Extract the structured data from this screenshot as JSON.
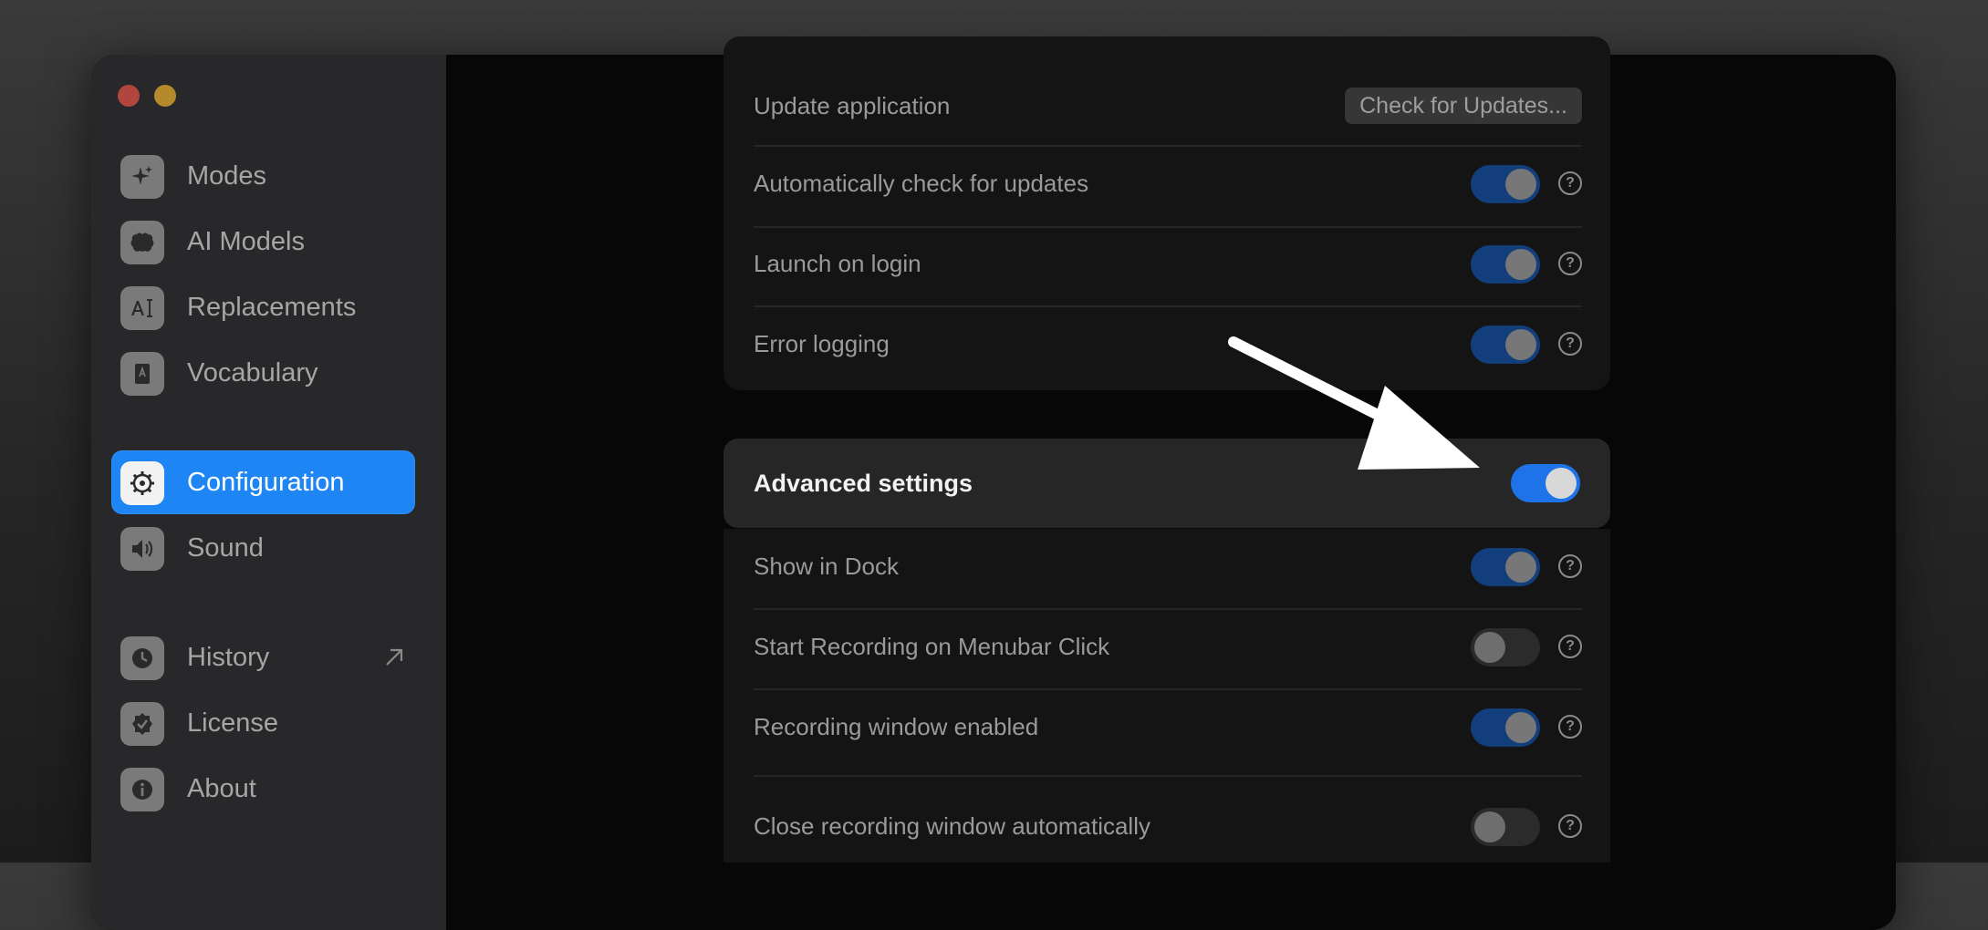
{
  "sidebar": {
    "items": [
      {
        "label": "Modes",
        "icon": "sparkle-icon",
        "name": "sidebar-item-modes"
      },
      {
        "label": "AI Models",
        "icon": "brain-icon",
        "name": "sidebar-item-ai-models"
      },
      {
        "label": "Replacements",
        "icon": "text-cursor-icon",
        "name": "sidebar-item-replacements"
      },
      {
        "label": "Vocabulary",
        "icon": "book-icon",
        "name": "sidebar-item-vocabulary"
      },
      {
        "label": "Configuration",
        "icon": "gear-icon",
        "name": "sidebar-item-configuration",
        "active": true
      },
      {
        "label": "Sound",
        "icon": "speaker-icon",
        "name": "sidebar-item-sound"
      },
      {
        "label": "History",
        "icon": "clock-icon",
        "name": "sidebar-item-history",
        "external": true
      },
      {
        "label": "License",
        "icon": "badge-check-icon",
        "name": "sidebar-item-license"
      },
      {
        "label": "About",
        "icon": "info-icon",
        "name": "sidebar-item-about"
      }
    ]
  },
  "general": {
    "update_label": "Update application",
    "update_button": "Check for Updates...",
    "rows": [
      {
        "label": "Automatically check for updates",
        "enabled": true
      },
      {
        "label": "Launch on login",
        "enabled": true
      },
      {
        "label": "Error logging",
        "enabled": true
      }
    ]
  },
  "advanced": {
    "label": "Advanced settings",
    "enabled": true,
    "rows": [
      {
        "label": "Show in Dock",
        "enabled": true
      },
      {
        "label": "Start Recording on Menubar Click",
        "enabled": false
      },
      {
        "label": "Recording window enabled",
        "enabled": true
      },
      {
        "label": "Close recording window automatically",
        "enabled": false
      }
    ]
  },
  "help_glyph": "?",
  "colors": {
    "accent": "#1e86f4",
    "toggle_on": "#123f7c",
    "toggle_on_active": "#1e73e8",
    "sidebar_bg": "#28282a"
  }
}
